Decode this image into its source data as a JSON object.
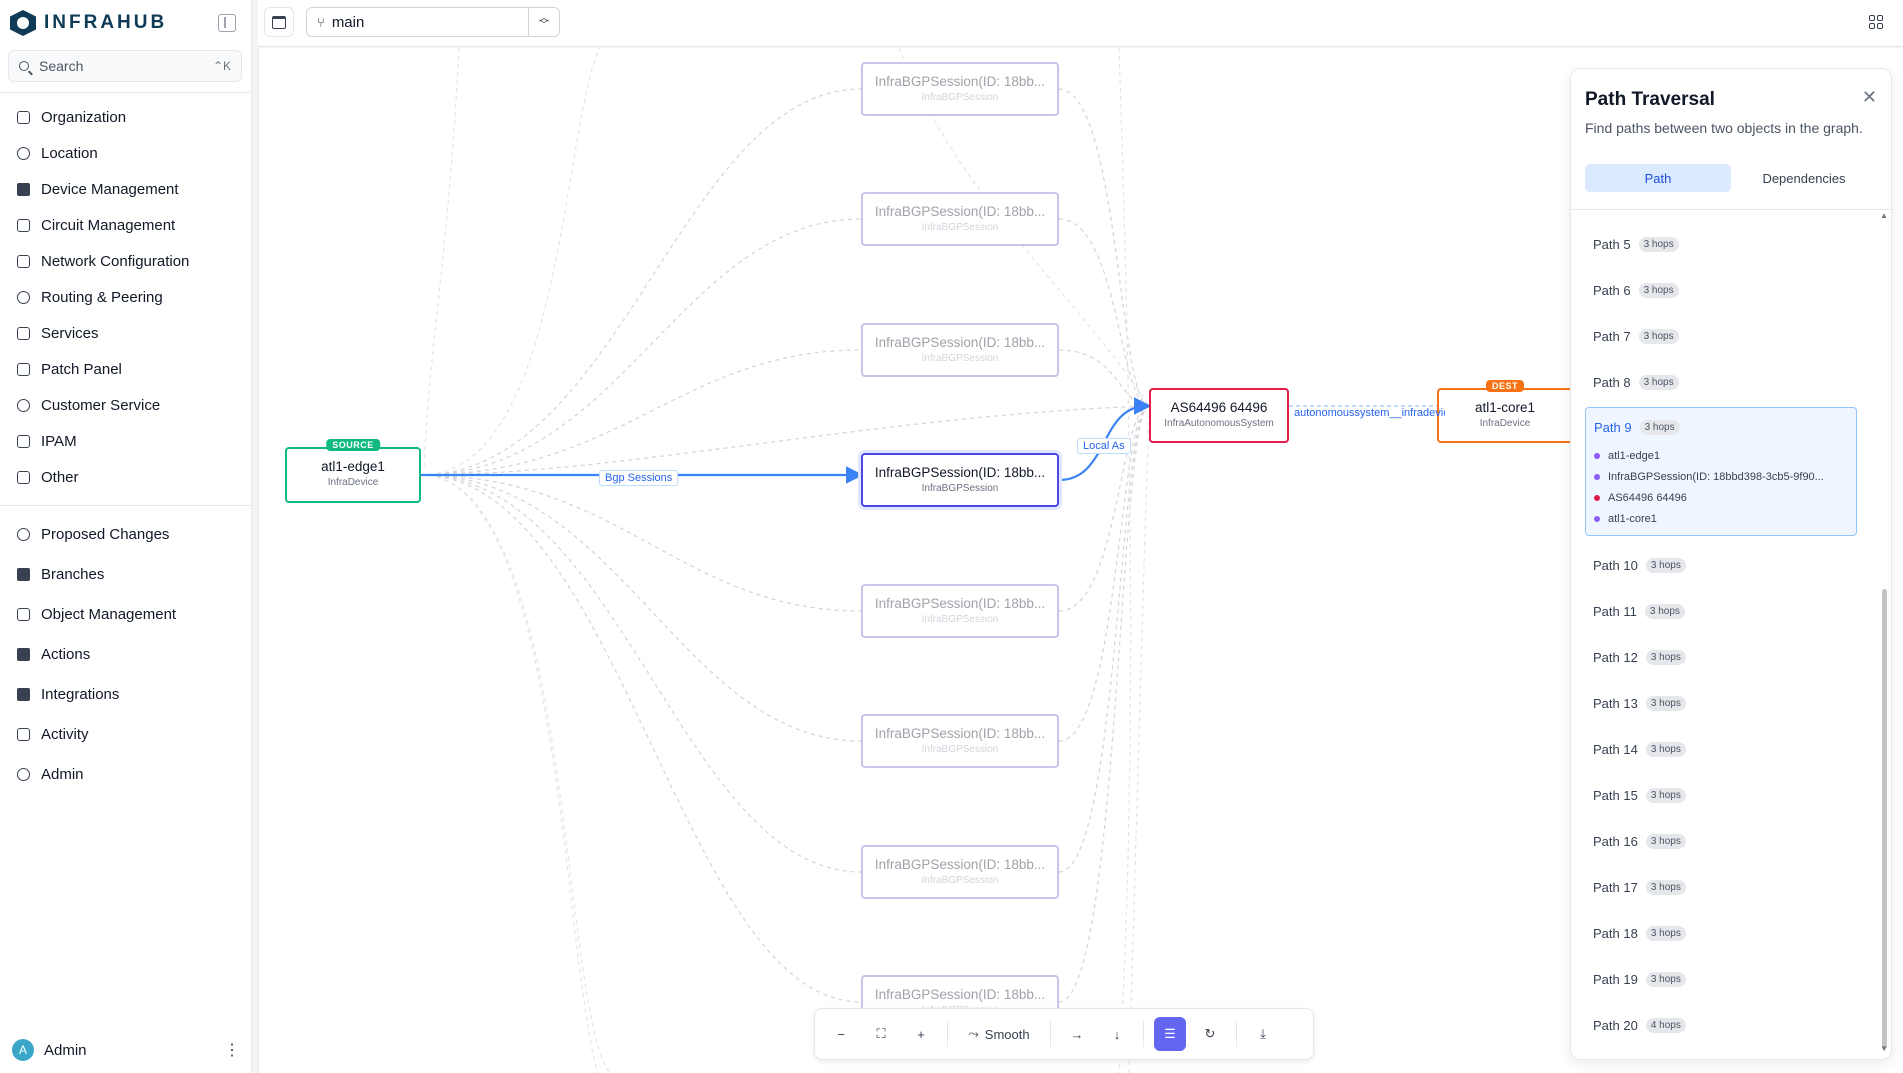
{
  "app": {
    "name": "INFRAHUB"
  },
  "search": {
    "placeholder": "Search",
    "shortcut": "⌃K"
  },
  "nav_primary": [
    {
      "label": "Organization",
      "icon": "building-icon"
    },
    {
      "label": "Location",
      "icon": "map-pin-icon"
    },
    {
      "label": "Device Management",
      "icon": "server-icon"
    },
    {
      "label": "Circuit Management",
      "icon": "circuit-icon"
    },
    {
      "label": "Network Configuration",
      "icon": "network-icon"
    },
    {
      "label": "Routing & Peering",
      "icon": "globe-icon"
    },
    {
      "label": "Services",
      "icon": "services-icon"
    },
    {
      "label": "Patch Panel",
      "icon": "patch-icon"
    },
    {
      "label": "Customer Service",
      "icon": "handshake-icon"
    },
    {
      "label": "IPAM",
      "icon": "ipam-icon"
    },
    {
      "label": "Other",
      "icon": "cube-icon"
    }
  ],
  "nav_secondary": [
    {
      "label": "Proposed Changes",
      "icon": "merge-icon"
    },
    {
      "label": "Branches",
      "icon": "layers-icon"
    },
    {
      "label": "Object Management",
      "icon": "cube-icon"
    },
    {
      "label": "Actions",
      "icon": "rocket-icon"
    },
    {
      "label": "Integrations",
      "icon": "plug-icon"
    },
    {
      "label": "Activity",
      "icon": "chart-icon"
    },
    {
      "label": "Admin",
      "icon": "gear-icon"
    }
  ],
  "user": {
    "initial": "A",
    "name": "Admin",
    "menu": "⋮"
  },
  "topbar": {
    "branch": "main"
  },
  "graph": {
    "source": {
      "badge": "SOURCE",
      "title": "atl1-edge1",
      "subtitle": "InfraDevice"
    },
    "sessions": [
      {
        "title": "InfraBGPSession(ID: 18bb...",
        "subtitle": "InfraBGPSession"
      },
      {
        "title": "InfraBGPSession(ID: 18bb...",
        "subtitle": "InfraBGPSession"
      },
      {
        "title": "InfraBGPSession(ID: 18bb...",
        "subtitle": "InfraBGPSession"
      },
      {
        "title": "InfraBGPSession(ID: 18bb...",
        "subtitle": "InfraBGPSession"
      },
      {
        "title": "InfraBGPSession(ID: 18bb...",
        "subtitle": "InfraBGPSession"
      },
      {
        "title": "InfraBGPSession(ID: 18bb...",
        "subtitle": "InfraBGPSession"
      },
      {
        "title": "InfraBGPSession(ID: 18bb...",
        "subtitle": "InfraBGPSession"
      },
      {
        "title": "InfraBGPSession(ID: 18bb...",
        "subtitle": "InfraBGPSession"
      }
    ],
    "asn": {
      "title": "AS64496 64496",
      "subtitle": "InfraAutonomousSystem"
    },
    "dest": {
      "badge": "DEST",
      "title": "atl1-core1",
      "subtitle": "InfraDevice"
    },
    "edge_labels": {
      "bgp": "Bgp Sessions",
      "local_as": "Local As",
      "as_device": "autonomoussystem__infradevice"
    }
  },
  "toolbar": {
    "smooth_label": "Smooth"
  },
  "panel": {
    "title": "Path Traversal",
    "description": "Find paths between two objects in the graph.",
    "tabs": [
      "Path",
      "Dependencies"
    ],
    "paths": [
      {
        "label": "Path 5",
        "hops": "3 hops"
      },
      {
        "label": "Path 6",
        "hops": "3 hops"
      },
      {
        "label": "Path 7",
        "hops": "3 hops"
      },
      {
        "label": "Path 8",
        "hops": "3 hops"
      },
      {
        "label": "Path 9",
        "hops": "3 hops"
      },
      {
        "label": "Path 10",
        "hops": "3 hops"
      },
      {
        "label": "Path 11",
        "hops": "3 hops"
      },
      {
        "label": "Path 12",
        "hops": "3 hops"
      },
      {
        "label": "Path 13",
        "hops": "3 hops"
      },
      {
        "label": "Path 14",
        "hops": "3 hops"
      },
      {
        "label": "Path 15",
        "hops": "3 hops"
      },
      {
        "label": "Path 16",
        "hops": "3 hops"
      },
      {
        "label": "Path 17",
        "hops": "3 hops"
      },
      {
        "label": "Path 18",
        "hops": "3 hops"
      },
      {
        "label": "Path 19",
        "hops": "3 hops"
      },
      {
        "label": "Path 20",
        "hops": "4 hops"
      }
    ],
    "selected_hops": [
      {
        "label": "atl1-edge1",
        "color": "#8b5cf6"
      },
      {
        "label": "InfraBGPSession(ID: 18bbd398-3cb5-9f90...",
        "color": "#8b5cf6"
      },
      {
        "label": "AS64496 64496",
        "color": "#e11d48"
      },
      {
        "label": "atl1-core1",
        "color": "#8b5cf6"
      }
    ]
  }
}
